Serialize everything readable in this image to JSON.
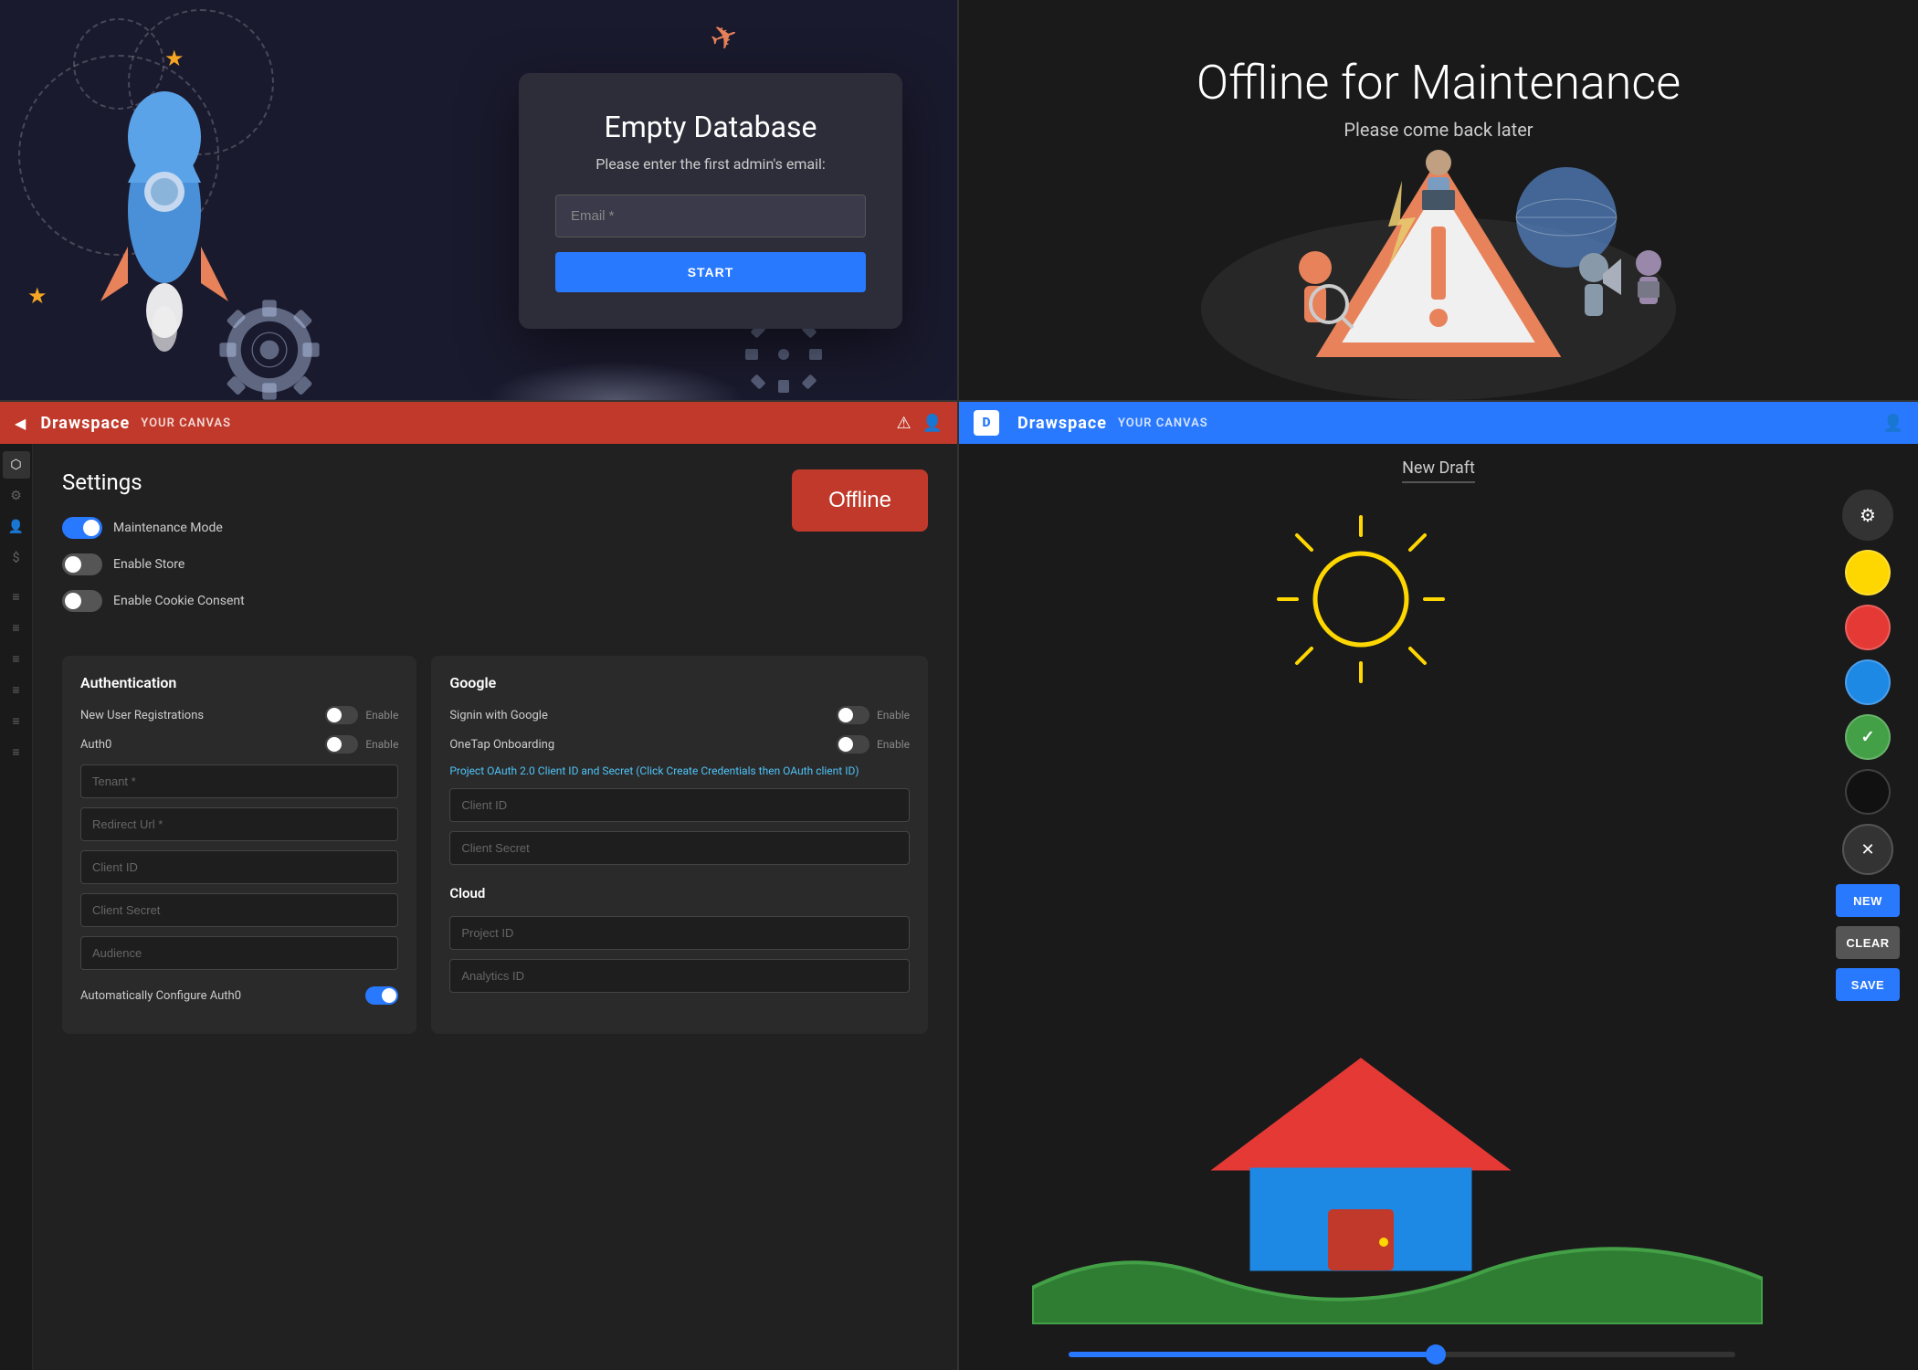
{
  "topLeft": {
    "dialog": {
      "title": "Empty Database",
      "subtitle": "Please enter the first admin's email:",
      "emailPlaceholder": "Email *",
      "startLabel": "START"
    }
  },
  "topRight": {
    "title": "Offline for Maintenance",
    "subtitle": "Please come back later"
  },
  "bottomLeft": {
    "header": {
      "brand": "Drawspace",
      "canvas": "YOUR CANVAS"
    },
    "settings": {
      "title": "Settings",
      "toggles": [
        {
          "id": "maintenance",
          "label": "Maintenance Mode",
          "on": true
        },
        {
          "id": "store",
          "label": "Enable Store",
          "on": false
        },
        {
          "id": "cookie",
          "label": "Enable Cookie Consent",
          "on": false
        }
      ],
      "offlineBtn": "Offline",
      "auth": {
        "title": "Authentication",
        "fields": [
          {
            "label": "New User Registrations",
            "enableText": "Enable"
          },
          {
            "label": "Auth0",
            "enableText": "Enable"
          }
        ],
        "inputs": [
          "Tenant *",
          "Redirect Url *",
          "Client ID",
          "Client Secret",
          "Audience"
        ],
        "bottomToggle": "Automatically Configure Auth0"
      },
      "google": {
        "title": "Google",
        "fields": [
          {
            "label": "Signin with Google",
            "enableText": "Enable"
          },
          {
            "label": "OneTap Onboarding",
            "enableText": "Enable"
          }
        ],
        "linkText": "Project OAuth 2.0 Client ID and Secret (Click Create Credentials then OAuth client ID)",
        "inputs": [
          "Client ID",
          "Client Secret"
        ],
        "cloudTitle": "Cloud",
        "cloudInputs": [
          "Project ID",
          "Analytics ID"
        ]
      }
    }
  },
  "bottomRight": {
    "header": {
      "brand": "Drawspace",
      "canvas": "YOUR CANVAS"
    },
    "canvas": {
      "title": "New Draft"
    },
    "toolbar": {
      "colors": [
        {
          "id": "yellow",
          "hex": "#FFD700",
          "selected": false
        },
        {
          "id": "red",
          "hex": "#e53935",
          "selected": false
        },
        {
          "id": "blue",
          "hex": "#1e88e5",
          "selected": false
        },
        {
          "id": "green",
          "hex": "#43a047",
          "selected": true
        },
        {
          "id": "black",
          "hex": "#111111",
          "selected": false
        }
      ],
      "buttons": {
        "new": "NEW",
        "clear": "CLEAR",
        "save": "SAVE"
      }
    }
  },
  "sideNav": {
    "items": [
      {
        "icon": "◀",
        "name": "collapse"
      },
      {
        "icon": "⬡",
        "name": "shapes"
      },
      {
        "icon": "⚙",
        "name": "settings"
      },
      {
        "icon": "👤",
        "name": "users"
      },
      {
        "icon": "$",
        "name": "billing"
      },
      {
        "icon": "≡",
        "name": "menu1"
      },
      {
        "icon": "≡",
        "name": "menu2"
      },
      {
        "icon": "≡",
        "name": "menu3"
      },
      {
        "icon": "≡",
        "name": "menu4"
      },
      {
        "icon": "≡",
        "name": "menu5"
      },
      {
        "icon": "≡",
        "name": "menu6"
      }
    ]
  }
}
